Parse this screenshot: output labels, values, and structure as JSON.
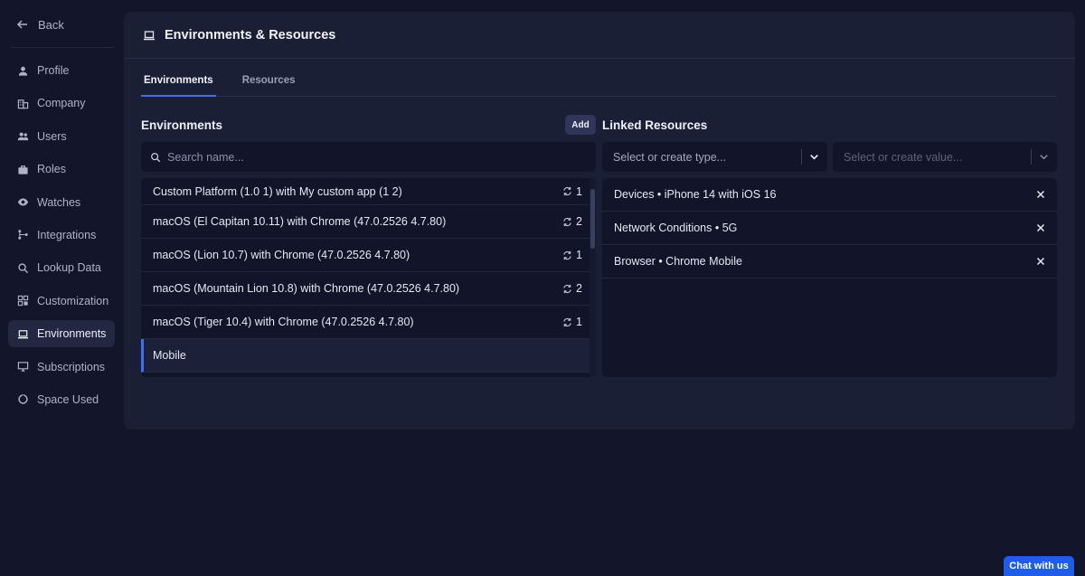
{
  "sidebar": {
    "back_label": "Back",
    "items": [
      {
        "label": "Profile",
        "icon": "user-icon"
      },
      {
        "label": "Company",
        "icon": "building-icon"
      },
      {
        "label": "Users",
        "icon": "users-icon"
      },
      {
        "label": "Roles",
        "icon": "briefcase-icon"
      },
      {
        "label": "Watches",
        "icon": "eye-icon"
      },
      {
        "label": "Integrations",
        "icon": "integrations-icon"
      },
      {
        "label": "Lookup Data",
        "icon": "search-icon"
      },
      {
        "label": "Customization",
        "icon": "grid-icon"
      },
      {
        "label": "Environments",
        "icon": "laptop-icon",
        "active": true
      },
      {
        "label": "Subscriptions",
        "icon": "monitor-icon"
      },
      {
        "label": "Space Used",
        "icon": "pie-icon"
      }
    ]
  },
  "header": {
    "title": "Environments & Resources"
  },
  "tabs": [
    {
      "label": "Environments",
      "active": true
    },
    {
      "label": "Resources",
      "active": false
    }
  ],
  "environments": {
    "title": "Environments",
    "add_label": "Add",
    "search_placeholder": "Search name...",
    "items": [
      {
        "name": "Custom Platform (1.0 1) with My custom app (1 2)",
        "count": "1"
      },
      {
        "name": "macOS (El Capitan 10.11) with Chrome (47.0.2526 4.7.80)",
        "count": "2"
      },
      {
        "name": "macOS (Lion 10.7) with Chrome (47.0.2526 4.7.80)",
        "count": "1"
      },
      {
        "name": "macOS (Mountain Lion 10.8) with Chrome (47.0.2526 4.7.80)",
        "count": "2"
      },
      {
        "name": "macOS (Tiger 10.4) with Chrome (47.0.2526 4.7.80)",
        "count": "1"
      },
      {
        "name": "Mobile",
        "count": ""
      }
    ]
  },
  "linked": {
    "title": "Linked Resources",
    "type_placeholder": "Select or create type...",
    "value_placeholder": "Select or create value...",
    "items": [
      "Devices • iPhone 14 with iOS 16",
      "Network Conditions • 5G",
      "Browser • Chrome Mobile"
    ]
  },
  "chat_label": "Chat with us",
  "colors": {
    "accent": "#3f6ff0",
    "background": "#13152a",
    "panel": "#1b1f35",
    "chat": "#1f5ce8"
  }
}
